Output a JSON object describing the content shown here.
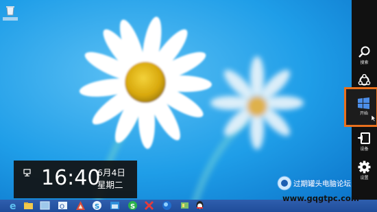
{
  "clock": {
    "time": "16:40",
    "date": "6月4日",
    "weekday": "星期二"
  },
  "charms": [
    {
      "label": "搜索",
      "icon": "search-icon"
    },
    {
      "label": "共享",
      "icon": "share-icon"
    },
    {
      "label": "开始",
      "icon": "windows-start-icon"
    },
    {
      "label": "设备",
      "icon": "devices-icon"
    },
    {
      "label": "设置",
      "icon": "gear-icon"
    }
  ],
  "highlight_color": "#e8701e",
  "taskbar": [
    "ie-icon",
    "folder-icon",
    "explorer-window-icon",
    "outlook-icon",
    "app-a-icon",
    "app-s-icon",
    "app-photos-icon",
    "app-green-icon",
    "app-globe-icon",
    "app-tools-icon",
    "qq-icon"
  ],
  "watermark": {
    "title": "过期罐头电脑论坛",
    "url": "www.gqgtpc.com"
  }
}
